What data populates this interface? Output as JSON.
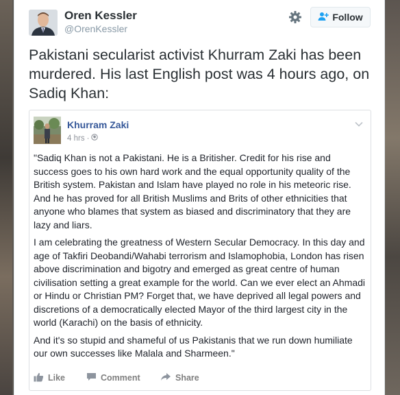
{
  "tweet": {
    "author_name": "Oren Kessler",
    "author_handle": "@OrenKessler",
    "follow_label": "Follow",
    "text": "Pakistani secularist activist Khurram Zaki has been murdered. His last English post was 4 hours ago, on Sadiq Khan:"
  },
  "embedded_post": {
    "author_name": "Khurram Zaki",
    "timestamp": "4 hrs",
    "paragraphs": [
      "\"Sadiq Khan is not a Pakistani. He is a Britisher. Credit for his rise and success goes to his own hard work and the equal opportunity quality of the British system. Pakistan and Islam have played no role in his meteoric rise. And he has proved for all British Muslims and Brits of other ethnicities that anyone who blames that system as biased and discriminatory that they are lazy and liars.",
      "I am celebrating the greatness of Western Secular Democracy. In this day and age of Takfiri Deobandi/Wahabi terrorism and Islamophobia, London has risen above discrimination and bigotry and emerged as great centre of human civilisation setting a great example for the world. Can we ever elect an Ahmadi or Hindu or Christian PM? Forget that, we have deprived all legal powers and discretions of a democratically elected Mayor of the third largest city in the world (Karachi) on the basis of ethnicity.",
      "And it's so stupid and shameful of us Pakistanis that we run down humiliate our own successes like Malala and Sharmeen.\""
    ],
    "actions": {
      "like": "Like",
      "comment": "Comment",
      "share": "Share"
    }
  },
  "colors": {
    "fb_link": "#365899",
    "text": "#292f33",
    "muted": "#8899a6"
  },
  "icons": [
    "gear-icon",
    "follow-person-icon",
    "globe-icon",
    "chevron-down-icon",
    "like-icon",
    "comment-icon",
    "share-icon"
  ]
}
